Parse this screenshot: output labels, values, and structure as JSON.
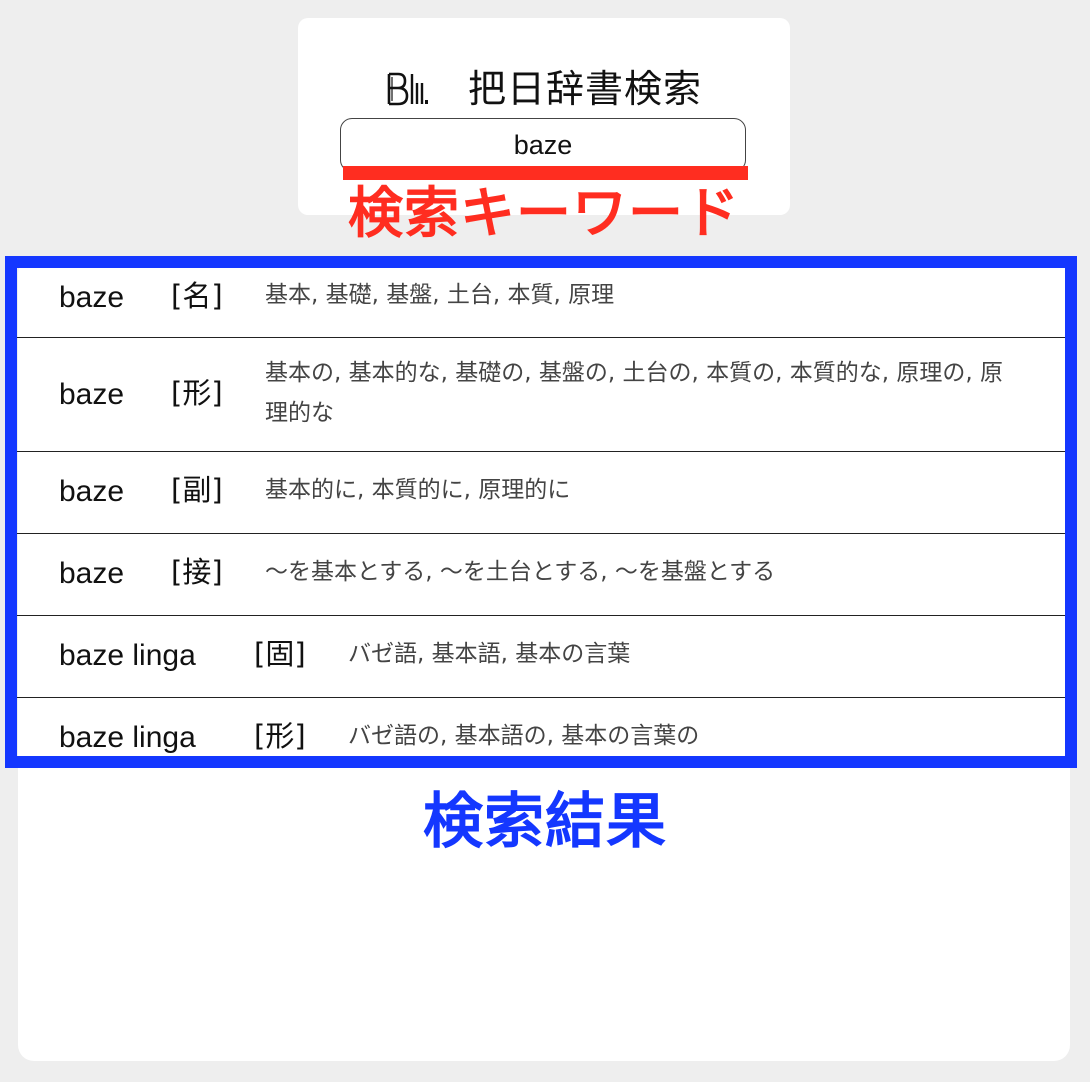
{
  "header": {
    "logo_icon": "bl-logo-icon",
    "title": "把日辞書検索"
  },
  "search": {
    "value": "baze"
  },
  "annotations": {
    "keyword_label": "検索キーワード",
    "keyword_color": "#ff2d20",
    "results_label": "検索結果",
    "results_color": "#1437ff"
  },
  "results": [
    {
      "word": "baze",
      "pos": "[名]",
      "meanings": "基本, 基礎, 基盤, 土台, 本質, 原理"
    },
    {
      "word": "baze",
      "pos": "[形]",
      "meanings": "基本の, 基本的な, 基礎の, 基盤の, 土台の, 本質の, 本質的な, 原理の, 原理的な"
    },
    {
      "word": "baze",
      "pos": "[副]",
      "meanings": "基本的に, 本質的に, 原理的に"
    },
    {
      "word": "baze",
      "pos": "[接]",
      "meanings": "〜を基本とする, 〜を土台とする, 〜を基盤とする"
    },
    {
      "word": "baze linga",
      "pos": "[固]",
      "meanings": "バゼ語, 基本語, 基本の言葉"
    },
    {
      "word": "baze linga",
      "pos": "[形]",
      "meanings": "バゼ語の, 基本語の, 基本の言葉の"
    }
  ]
}
